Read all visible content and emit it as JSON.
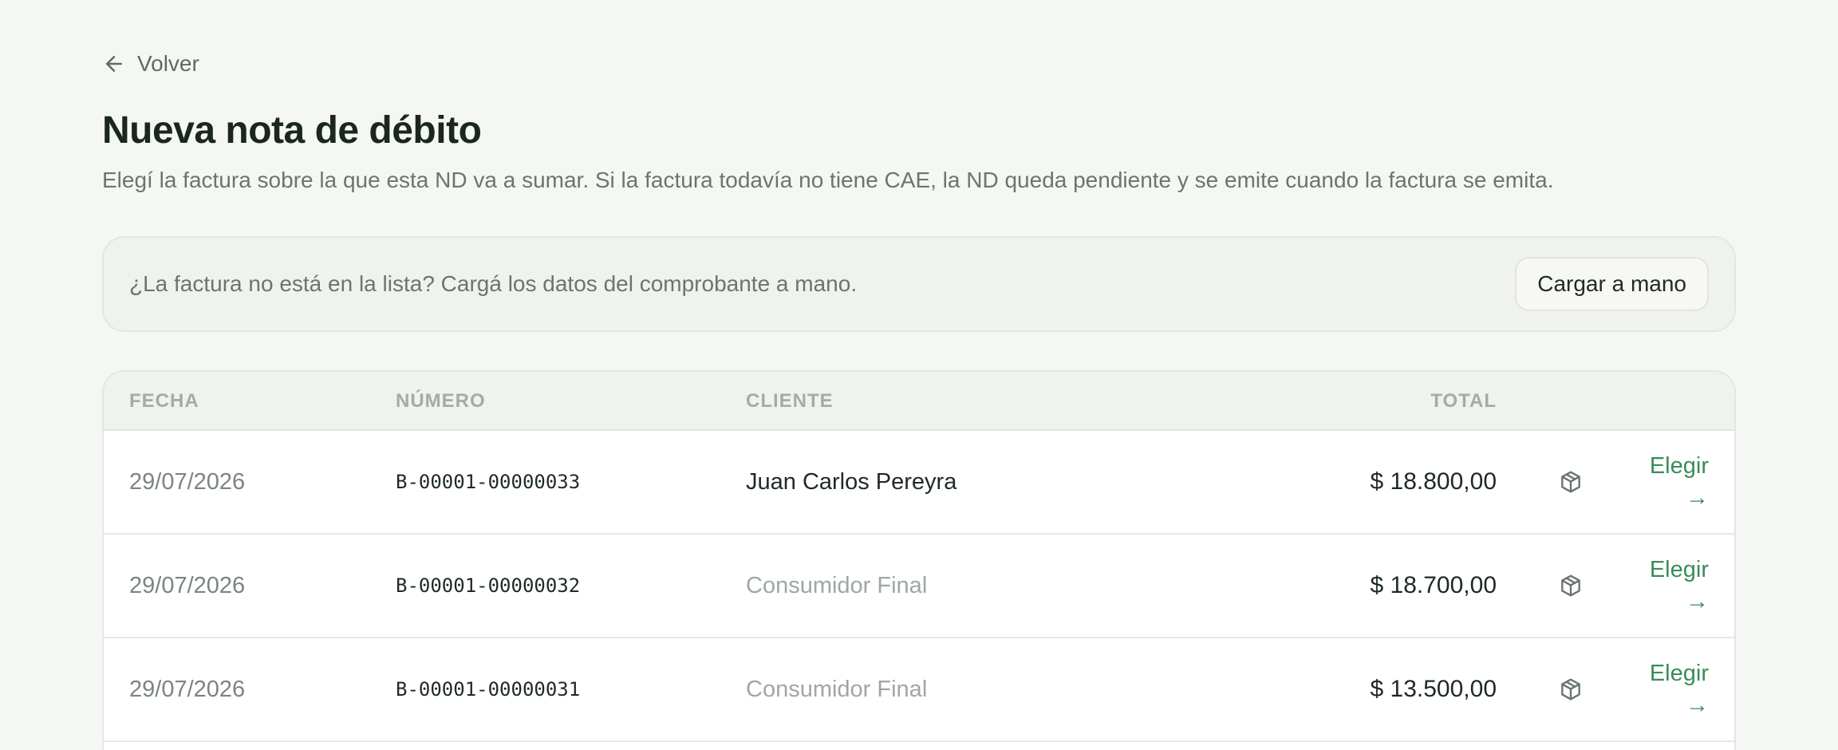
{
  "back": {
    "label": "Volver"
  },
  "page": {
    "title": "Nueva nota de débito",
    "subtitle": "Elegí la factura sobre la que esta ND va a sumar. Si la factura todavía no tiene CAE, la ND queda pendiente y se emite cuando la factura se emita."
  },
  "notice": {
    "text": "¿La factura no está en la lista? Cargá los datos del comprobante a mano.",
    "button_label": "Cargar a mano"
  },
  "table": {
    "columns": {
      "fecha": "FECHA",
      "numero": "NÚMERO",
      "cliente": "CLIENTE",
      "total": "TOTAL"
    },
    "rows": [
      {
        "fecha": "29/07/2026",
        "numero": "B-00001-00000033",
        "cliente": "Juan Carlos Pereyra",
        "total": "$ 18.800,00",
        "action": "Elegir",
        "arrow": "→",
        "icon": "package-icon"
      },
      {
        "fecha": "29/07/2026",
        "numero": "B-00001-00000032",
        "cliente": "Consumidor Final",
        "total": "$ 18.700,00",
        "action": "Elegir",
        "arrow": "→",
        "icon": "package-icon"
      },
      {
        "fecha": "29/07/2026",
        "numero": "B-00001-00000031",
        "cliente": "Consumidor Final",
        "total": "$ 13.500,00",
        "action": "Elegir",
        "arrow": "→",
        "icon": "package-icon"
      }
    ]
  },
  "colors": {
    "accent": "#3a8c5c",
    "background": "#f5f7f4",
    "muted_text": "#6b756f"
  }
}
